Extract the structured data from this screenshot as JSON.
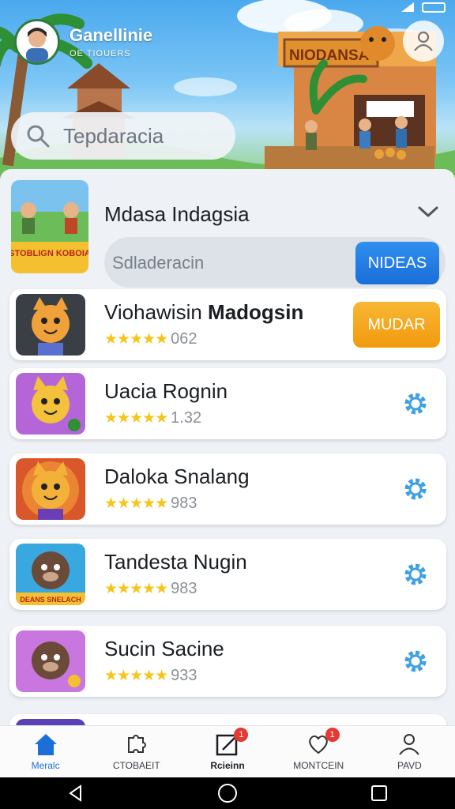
{
  "header": {
    "profile_name": "Ganellinie",
    "profile_subtitle": "OE TIOUERS",
    "banner_sign": "NIODANSA"
  },
  "search": {
    "placeholder": "Tepdaracia"
  },
  "featured": {
    "title": "Mdasa Indagsia",
    "icon_caption": "STOBLIGN KOBOIA",
    "bar_text": "Sdladeracin",
    "button_label": "NIDEAS"
  },
  "apps": [
    {
      "title": "Viohawisin ",
      "title_bold": "Madogsin",
      "stars": "★★★★★",
      "score": "062",
      "action": "MUDAR"
    },
    {
      "title": "Uacia Rognin",
      "stars": "★★★★★",
      "score": "1.32"
    },
    {
      "title": "Daloka Snalang",
      "stars": "★★★★★",
      "score": "983"
    },
    {
      "title": "Tandesta Nugin",
      "stars": "★★★★★",
      "score": "983",
      "icon_caption": "DEANS SNELACH"
    },
    {
      "title": "Sucin Sacine",
      "stars": "★★★★★",
      "score": "933"
    }
  ],
  "nav": [
    {
      "label": "Meralc",
      "icon": "home-icon",
      "active": true
    },
    {
      "label": "CTOBAEIT",
      "icon": "puzzle-icon"
    },
    {
      "label": "Rcieinn",
      "icon": "edit-icon",
      "badge": "1"
    },
    {
      "label": "MONTCEIN",
      "icon": "heart-chat-icon",
      "badge": "1"
    },
    {
      "label": "PAVD",
      "icon": "user-icon"
    }
  ],
  "colors": {
    "accent": "#1c6fd8",
    "action_orange": "#f29a0e",
    "star": "#f5c518",
    "badge": "#e53935"
  }
}
